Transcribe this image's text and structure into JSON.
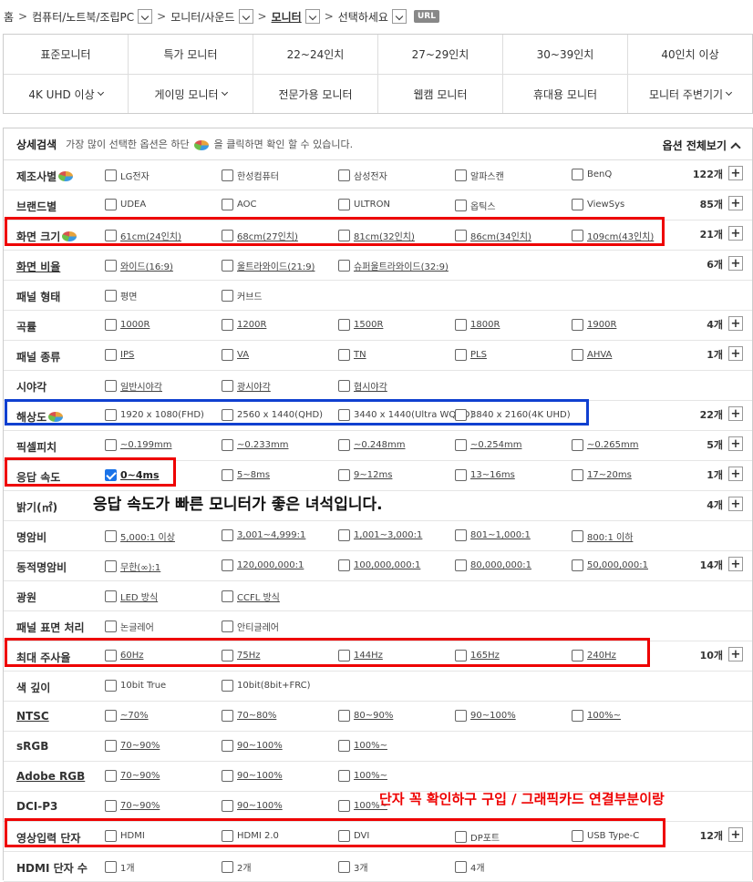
{
  "breadcrumb": {
    "home": "홈",
    "level1": "컴퓨터/노트북/조립PC",
    "level2": "모니터/사운드",
    "level3": "모니터",
    "level4": "선택하세요",
    "url_badge": "URL"
  },
  "categories": {
    "row1": [
      "표준모니터",
      "특가 모니터",
      "22~24인치",
      "27~29인치",
      "30~39인치",
      "40인치 이상"
    ],
    "row2": [
      {
        "label": "4K UHD 이상",
        "dropdown": true
      },
      {
        "label": "게이밍 모니터",
        "dropdown": true
      },
      {
        "label": "전문가용 모니터",
        "dropdown": false
      },
      {
        "label": "웹캠 모니터",
        "dropdown": false
      },
      {
        "label": "휴대용 모니터",
        "dropdown": false
      },
      {
        "label": "모니터 주변기기",
        "dropdown": true
      }
    ]
  },
  "detail": {
    "title": "상세검색",
    "desc_before": "가장 많이 선택한 옵션은 하단",
    "desc_after": "을 클릭하면 확인 할 수 있습니다.",
    "show_all": "옵션 전체보기"
  },
  "filters": [
    {
      "label": "제조사별",
      "pie": true,
      "options": [
        "LG전자",
        "한성컴퓨터",
        "삼성전자",
        "알파스캔",
        "BenQ"
      ],
      "count": "122개"
    },
    {
      "label": "브랜드별",
      "options": [
        "UDEA",
        "AOC",
        "ULTRON",
        "옵틱스",
        "ViewSys"
      ],
      "count": "85개"
    },
    {
      "label": "화면 크기",
      "pie": true,
      "options": [
        "61cm(24인치)",
        "68cm(27인치)",
        "81cm(32인치)",
        "86cm(34인치)",
        "109cm(43인치)"
      ],
      "count": "21개",
      "link": true
    },
    {
      "label": "화면 비율",
      "underline": true,
      "options": [
        "와이드(16:9)",
        "울트라와이드(21:9)",
        "슈퍼울트라와이드(32:9)"
      ],
      "count": "6개",
      "link": true
    },
    {
      "label": "패널 형태",
      "options": [
        "평면",
        "커브드"
      ]
    },
    {
      "label": "곡률",
      "options": [
        "1000R",
        "1200R",
        "1500R",
        "1800R",
        "1900R"
      ],
      "count": "4개",
      "link": true
    },
    {
      "label": "패널 종류",
      "options": [
        "IPS",
        "VA",
        "TN",
        "PLS",
        "AHVA"
      ],
      "count": "1개",
      "link": true
    },
    {
      "label": "시야각",
      "options": [
        "일반시야각",
        "광시야각",
        "협시야각"
      ],
      "link": true
    },
    {
      "label": "해상도",
      "pie": true,
      "options": [
        "1920 x 1080(FHD)",
        "2560 x 1440(QHD)",
        "3440 x 1440(Ultra WQHD)",
        "3840 x 2160(4K UHD)"
      ],
      "count": "22개"
    },
    {
      "label": "픽셀피치",
      "options": [
        "~0.199mm",
        "~0.233mm",
        "~0.248mm",
        "~0.254mm",
        "~0.265mm"
      ],
      "count": "5개",
      "link": true
    },
    {
      "label": "응답 속도",
      "options": [
        "0~4ms",
        "5~8ms",
        "9~12ms",
        "13~16ms",
        "17~20ms"
      ],
      "checked": 0,
      "count": "1개",
      "link": true
    },
    {
      "label": "밝기(㎡)",
      "options": [],
      "count": "4개"
    },
    {
      "label": "명암비",
      "options": [
        "5,000:1 이상",
        "3,001~4,999:1",
        "1,001~3,000:1",
        "801~1,000:1",
        "800:1 이하"
      ],
      "link": true
    },
    {
      "label": "동적명암비",
      "options": [
        "무한(∞):1",
        "120,000,000:1",
        "100,000,000:1",
        "80,000,000:1",
        "50,000,000:1"
      ],
      "count": "14개",
      "link": true
    },
    {
      "label": "광원",
      "options": [
        "LED 방식",
        "CCFL 방식"
      ],
      "link": true
    },
    {
      "label": "패널 표면 처리",
      "options": [
        "논글레어",
        "안티글레어"
      ]
    },
    {
      "label": "최대 주사율",
      "options": [
        "60Hz",
        "75Hz",
        "144Hz",
        "165Hz",
        "240Hz"
      ],
      "count": "10개",
      "link": true
    },
    {
      "label": "색 깊이",
      "options": [
        "10bit True",
        "10bit(8bit+FRC)"
      ]
    },
    {
      "label": "NTSC",
      "underline": true,
      "options": [
        "~70%",
        "70~80%",
        "80~90%",
        "90~100%",
        "100%~"
      ],
      "link": true
    },
    {
      "label": "sRGB",
      "options": [
        "70~90%",
        "90~100%",
        "100%~"
      ],
      "link": true
    },
    {
      "label": "Adobe RGB",
      "underline": true,
      "options": [
        "70~90%",
        "90~100%",
        "100%~"
      ],
      "link": true
    },
    {
      "label": "DCI-P3",
      "options": [
        "70~90%",
        "90~100%",
        "100%~"
      ],
      "link": true
    },
    {
      "label": "영상입력 단자",
      "options": [
        "HDMI",
        "HDMI 2.0",
        "DVI",
        "DP포트",
        "USB Type-C"
      ],
      "count": "12개"
    },
    {
      "label": "HDMI 단자 수",
      "options": [
        "1개",
        "2개",
        "3개",
        "4개"
      ]
    }
  ],
  "annotations": {
    "response_note": "응답 속도가 빠른 모니터가 좋은 녀석입니다.",
    "port_note": "단자 꼭 확인하구 구입 / 그래픽카드 연결부분이랑"
  },
  "colors": {
    "highlight_red": "#e00000",
    "highlight_blue": "#1040d0",
    "checkbox_checked": "#1a73e8"
  }
}
